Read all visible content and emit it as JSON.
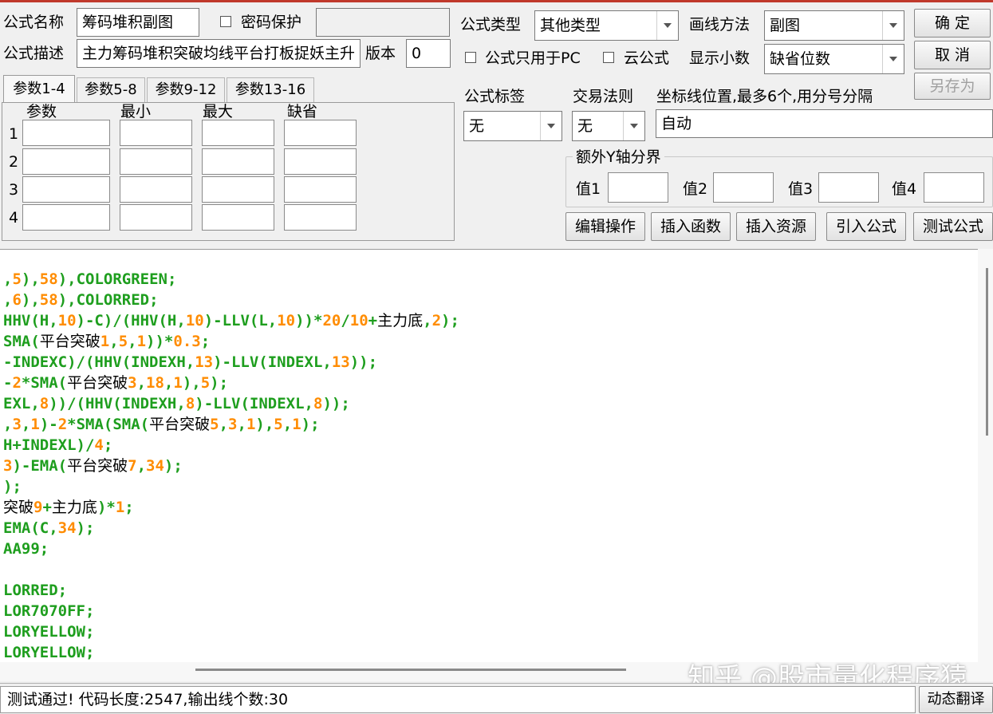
{
  "form": {
    "formula_name_label": "公式名称",
    "formula_name_value": "筹码堆积副图",
    "password_label": "密码保护",
    "formula_desc_label": "公式描述",
    "formula_desc_value": "主力筹码堆积突破均线平台打板捉妖主升",
    "version_label": "版本",
    "version_value": "0",
    "formula_type_label": "公式类型",
    "formula_type_value": "其他类型",
    "draw_method_label": "画线方法",
    "draw_method_value": "副图",
    "pc_only_label": "公式只用于PC",
    "cloud_label": "云公式",
    "decimals_label": "显示小数",
    "decimals_value": "缺省位数",
    "tag_label": "公式标签",
    "tag_value": "无",
    "rule_label": "交易法则",
    "rule_value": "无",
    "coord_label": "坐标线位置,最多6个,用分号分隔",
    "coord_value": "自动",
    "extra_y_label": "额外Y轴分界",
    "value_labels": [
      "值1",
      "值2",
      "值3",
      "值4"
    ]
  },
  "buttons": {
    "ok": "确  定",
    "cancel": "取  消",
    "save_as": "另存为",
    "edit_ops": "编辑操作",
    "insert_func": "插入函数",
    "insert_res": "插入资源",
    "import_formula": "引入公式",
    "test_formula": "测试公式",
    "dynamic_translate": "动态翻译"
  },
  "params": {
    "tabs": [
      "参数1-4",
      "参数5-8",
      "参数9-12",
      "参数13-16"
    ],
    "headers": [
      "参数",
      "最小",
      "最大",
      "缺省"
    ],
    "rows": [
      "1",
      "2",
      "3",
      "4"
    ]
  },
  "code_lines": [
    ",5),58),COLORGREEN;",
    ",6),58),COLORRED;",
    "HHV(H,10)-C)/(HHV(H,10)-LLV(L,10))*20/10+主力底,2);",
    "SMA(平台突破1,5,1))*0.3;",
    "-INDEXC)/(HHV(INDEXH,13)-LLV(INDEXL,13));",
    "-2*SMA(平台突破3,18,1),5);",
    "EXL,8))/(HHV(INDEXH,8)-LLV(INDEXL,8));",
    ",3,1)-2*SMA(SMA(平台突破5,3,1),5,1);",
    "H+INDEXL)/4;",
    "3)-EMA(平台突破7,34);",
    ");",
    "突破9+主力底)*1;",
    "EMA(C,34);",
    "AA99;",
    "",
    "LORRED;",
    "LOR7070FF;",
    "LORYELLOW;",
    "LORYELLOW;"
  ],
  "status": "测试通过! 代码长度:2547,输出线个数:30",
  "watermark": "知乎 @股市量化程序猿",
  "colors": {
    "keyword": "#1e9e1e",
    "number": "#ff8c00",
    "text": "#000000",
    "accent": "#c0392b"
  }
}
